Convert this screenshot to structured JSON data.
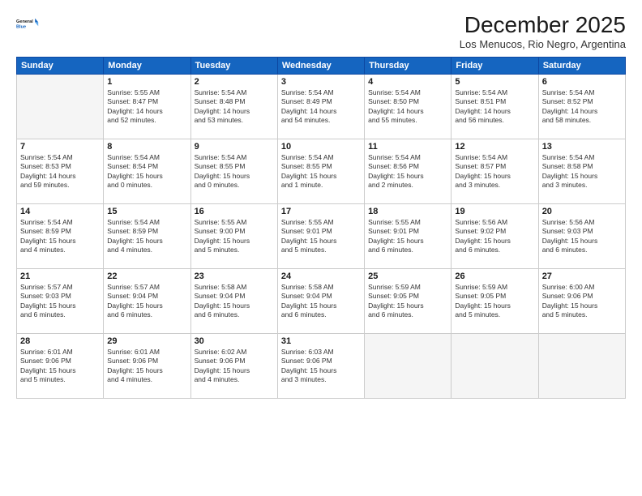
{
  "logo": {
    "line1": "General",
    "line2": "Blue"
  },
  "title": "December 2025",
  "location": "Los Menucos, Rio Negro, Argentina",
  "weekdays": [
    "Sunday",
    "Monday",
    "Tuesday",
    "Wednesday",
    "Thursday",
    "Friday",
    "Saturday"
  ],
  "weeks": [
    [
      {
        "day": "",
        "info": ""
      },
      {
        "day": "1",
        "info": "Sunrise: 5:55 AM\nSunset: 8:47 PM\nDaylight: 14 hours\nand 52 minutes."
      },
      {
        "day": "2",
        "info": "Sunrise: 5:54 AM\nSunset: 8:48 PM\nDaylight: 14 hours\nand 53 minutes."
      },
      {
        "day": "3",
        "info": "Sunrise: 5:54 AM\nSunset: 8:49 PM\nDaylight: 14 hours\nand 54 minutes."
      },
      {
        "day": "4",
        "info": "Sunrise: 5:54 AM\nSunset: 8:50 PM\nDaylight: 14 hours\nand 55 minutes."
      },
      {
        "day": "5",
        "info": "Sunrise: 5:54 AM\nSunset: 8:51 PM\nDaylight: 14 hours\nand 56 minutes."
      },
      {
        "day": "6",
        "info": "Sunrise: 5:54 AM\nSunset: 8:52 PM\nDaylight: 14 hours\nand 58 minutes."
      }
    ],
    [
      {
        "day": "7",
        "info": "Sunrise: 5:54 AM\nSunset: 8:53 PM\nDaylight: 14 hours\nand 59 minutes."
      },
      {
        "day": "8",
        "info": "Sunrise: 5:54 AM\nSunset: 8:54 PM\nDaylight: 15 hours\nand 0 minutes."
      },
      {
        "day": "9",
        "info": "Sunrise: 5:54 AM\nSunset: 8:55 PM\nDaylight: 15 hours\nand 0 minutes."
      },
      {
        "day": "10",
        "info": "Sunrise: 5:54 AM\nSunset: 8:55 PM\nDaylight: 15 hours\nand 1 minute."
      },
      {
        "day": "11",
        "info": "Sunrise: 5:54 AM\nSunset: 8:56 PM\nDaylight: 15 hours\nand 2 minutes."
      },
      {
        "day": "12",
        "info": "Sunrise: 5:54 AM\nSunset: 8:57 PM\nDaylight: 15 hours\nand 3 minutes."
      },
      {
        "day": "13",
        "info": "Sunrise: 5:54 AM\nSunset: 8:58 PM\nDaylight: 15 hours\nand 3 minutes."
      }
    ],
    [
      {
        "day": "14",
        "info": "Sunrise: 5:54 AM\nSunset: 8:59 PM\nDaylight: 15 hours\nand 4 minutes."
      },
      {
        "day": "15",
        "info": "Sunrise: 5:54 AM\nSunset: 8:59 PM\nDaylight: 15 hours\nand 4 minutes."
      },
      {
        "day": "16",
        "info": "Sunrise: 5:55 AM\nSunset: 9:00 PM\nDaylight: 15 hours\nand 5 minutes."
      },
      {
        "day": "17",
        "info": "Sunrise: 5:55 AM\nSunset: 9:01 PM\nDaylight: 15 hours\nand 5 minutes."
      },
      {
        "day": "18",
        "info": "Sunrise: 5:55 AM\nSunset: 9:01 PM\nDaylight: 15 hours\nand 6 minutes."
      },
      {
        "day": "19",
        "info": "Sunrise: 5:56 AM\nSunset: 9:02 PM\nDaylight: 15 hours\nand 6 minutes."
      },
      {
        "day": "20",
        "info": "Sunrise: 5:56 AM\nSunset: 9:03 PM\nDaylight: 15 hours\nand 6 minutes."
      }
    ],
    [
      {
        "day": "21",
        "info": "Sunrise: 5:57 AM\nSunset: 9:03 PM\nDaylight: 15 hours\nand 6 minutes."
      },
      {
        "day": "22",
        "info": "Sunrise: 5:57 AM\nSunset: 9:04 PM\nDaylight: 15 hours\nand 6 minutes."
      },
      {
        "day": "23",
        "info": "Sunrise: 5:58 AM\nSunset: 9:04 PM\nDaylight: 15 hours\nand 6 minutes."
      },
      {
        "day": "24",
        "info": "Sunrise: 5:58 AM\nSunset: 9:04 PM\nDaylight: 15 hours\nand 6 minutes."
      },
      {
        "day": "25",
        "info": "Sunrise: 5:59 AM\nSunset: 9:05 PM\nDaylight: 15 hours\nand 6 minutes."
      },
      {
        "day": "26",
        "info": "Sunrise: 5:59 AM\nSunset: 9:05 PM\nDaylight: 15 hours\nand 5 minutes."
      },
      {
        "day": "27",
        "info": "Sunrise: 6:00 AM\nSunset: 9:06 PM\nDaylight: 15 hours\nand 5 minutes."
      }
    ],
    [
      {
        "day": "28",
        "info": "Sunrise: 6:01 AM\nSunset: 9:06 PM\nDaylight: 15 hours\nand 5 minutes."
      },
      {
        "day": "29",
        "info": "Sunrise: 6:01 AM\nSunset: 9:06 PM\nDaylight: 15 hours\nand 4 minutes."
      },
      {
        "day": "30",
        "info": "Sunrise: 6:02 AM\nSunset: 9:06 PM\nDaylight: 15 hours\nand 4 minutes."
      },
      {
        "day": "31",
        "info": "Sunrise: 6:03 AM\nSunset: 9:06 PM\nDaylight: 15 hours\nand 3 minutes."
      },
      {
        "day": "",
        "info": ""
      },
      {
        "day": "",
        "info": ""
      },
      {
        "day": "",
        "info": ""
      }
    ]
  ]
}
